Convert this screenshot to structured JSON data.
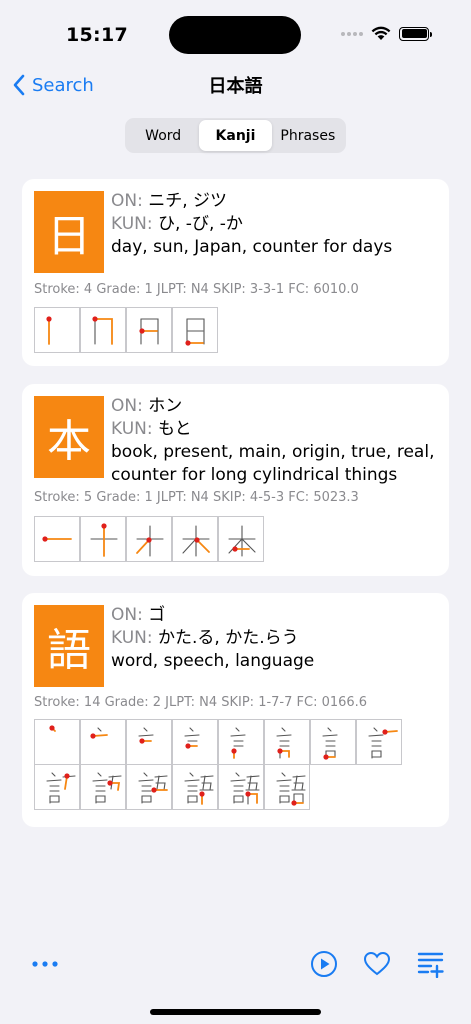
{
  "status_bar": {
    "time": "15:17"
  },
  "nav": {
    "back_label": "Search",
    "title": "日本語"
  },
  "segmented": {
    "options": [
      "Word",
      "Kanji",
      "Phrases"
    ],
    "selected": "Kanji"
  },
  "kanji": [
    {
      "character": "日",
      "on_label": "ON:",
      "on": "ニチ, ジツ",
      "kun_label": "KUN:",
      "kun": "ひ, -び, -か",
      "meaning": "day, sun, Japan, counter for days",
      "meta": "Stroke: 4 Grade: 1  JLPT: N4  SKIP: 3-3-1  FC: 6010.0",
      "stroke_count": 4
    },
    {
      "character": "本",
      "on_label": "ON:",
      "on": "ホン",
      "kun_label": "KUN:",
      "kun": "もと",
      "meaning": "book, present, main, origin, true, real, counter for long cylindrical things",
      "meta": "Stroke: 5 Grade: 1  JLPT: N4  SKIP: 4-5-3  FC: 5023.3",
      "stroke_count": 5
    },
    {
      "character": "語",
      "on_label": "ON:",
      "on": "ゴ",
      "kun_label": "KUN:",
      "kun": "かた.る, かた.らう",
      "meaning": "word, speech, language",
      "meta": "Stroke: 14 Grade: 2  JLPT: N4  SKIP: 1-7-7  FC: 0166.6",
      "stroke_count": 14
    }
  ],
  "toolbar": {
    "more_icon": "ellipsis-icon",
    "play_icon": "play-circle-icon",
    "favorite_icon": "heart-icon",
    "add_list_icon": "list-add-icon"
  },
  "colors": {
    "accent": "#1a7cf2",
    "kanji_bg": "#f68712",
    "stroke_new": "#f68712",
    "stroke_start": "#e0201b"
  }
}
